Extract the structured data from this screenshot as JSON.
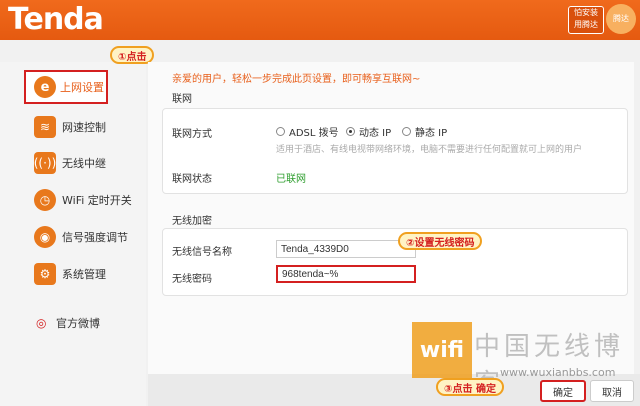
{
  "header": {
    "logo": "Tenda",
    "install_btn_line1": "怕安装",
    "install_btn_line2": "用腾达",
    "brand_badge": "腾达"
  },
  "sidebar": {
    "items": [
      {
        "label": "上网设置",
        "icon": "ie-icon",
        "active": true
      },
      {
        "label": "网速控制",
        "icon": "speed-icon"
      },
      {
        "label": "无线中继",
        "icon": "repeater-icon"
      },
      {
        "label": "WiFi 定时开关",
        "icon": "clock-icon"
      },
      {
        "label": "信号强度调节",
        "icon": "signal-icon"
      },
      {
        "label": "系统管理",
        "icon": "gear-icon"
      }
    ],
    "weibo": "官方微博"
  },
  "main": {
    "welcome": "亲爱的用户，轻松一步完成此页设置，即可畅享互联网~",
    "internet_section": "联网",
    "conn_mode_label": "联网方式",
    "modes": [
      "ADSL 拨号",
      "动态 IP",
      "静态 IP"
    ],
    "selected_mode": "动态 IP",
    "hint": "适用于酒店、有线电视带网络环境，电脑不需要进行任何配置就可上网的用户",
    "status_label": "联网状态",
    "status_value": "已联网",
    "wireless_section": "无线加密",
    "ssid_label": "无线信号名称",
    "ssid_value": "Tenda_4339D0",
    "password_label": "无线密码",
    "password_value": "968tenda~%"
  },
  "annotations": {
    "step1": "①点击",
    "step2": "②设置无线密码",
    "step3": "③点击  确定"
  },
  "buttons": {
    "ok": "确定",
    "cancel": "取消"
  },
  "watermark": {
    "wifi": "wifi",
    "title": "中国无线博客",
    "url": "www.wuxianbbs.com"
  },
  "colors": {
    "brand_orange": "#e8601c",
    "highlight_red": "#d42020",
    "status_green": "#2f9e2f"
  }
}
